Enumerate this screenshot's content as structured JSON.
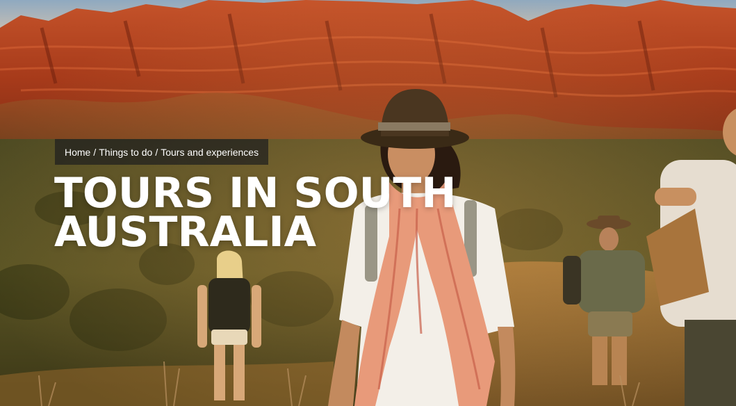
{
  "breadcrumb": {
    "items": [
      "Home",
      "Things to do",
      "Tours and experiences"
    ],
    "separator": "/"
  },
  "hero": {
    "title_line1": "TOURS IN SOUTH",
    "title_line2": "AUSTRALIA",
    "image": "hikers walking on a hill in front of red ranges at sunset"
  },
  "colors": {
    "title": "#ffffff",
    "breadcrumb_bg": "#1e1e1e",
    "range_red": "#b8401c",
    "scrub_green": "#4a4a1c"
  }
}
